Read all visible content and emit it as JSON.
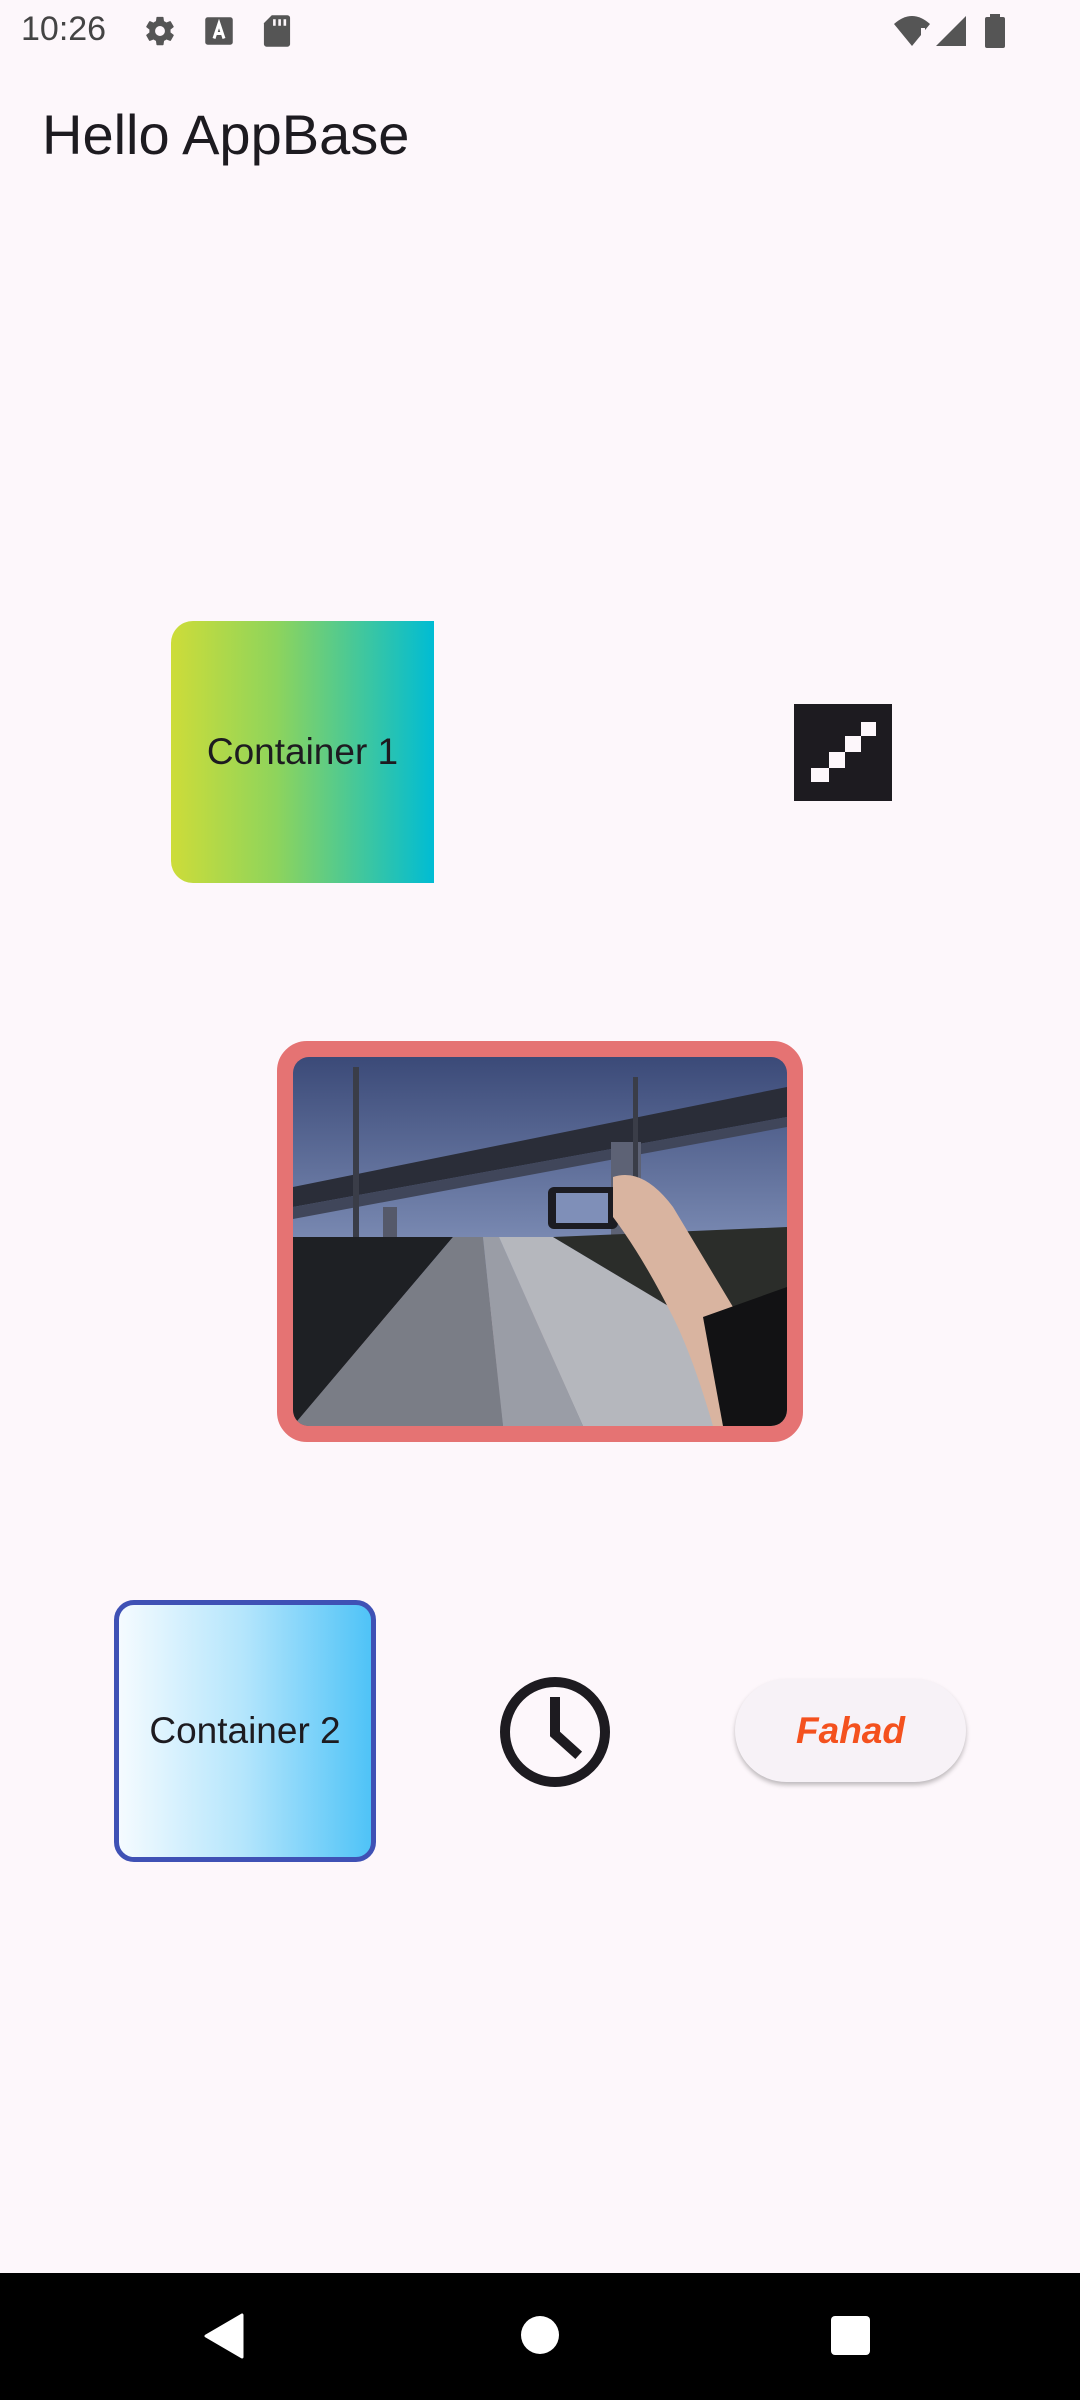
{
  "status_bar": {
    "time": "10:26",
    "left_icons": [
      "settings-icon",
      "text-a-icon",
      "sd-card-icon"
    ],
    "right_icons": [
      "wifi-alert-icon",
      "cell-signal-icon",
      "battery-icon"
    ]
  },
  "app_bar": {
    "title": "Hello AppBase"
  },
  "container1": {
    "label": "Container 1",
    "gradient": [
      "#cddc39",
      "#00bcd4"
    ]
  },
  "stairs": {
    "icon": "stairs-icon"
  },
  "photo": {
    "icon": "photo-image",
    "border_color": "#e57373"
  },
  "container2": {
    "label": "Container 2",
    "gradient": [
      "#f5fbff",
      "#4fc3f7"
    ],
    "border_color": "#3f51b5"
  },
  "clock": {
    "icon": "clock-icon"
  },
  "button": {
    "label": "Fahad",
    "color": "#f4511e"
  },
  "nav_bar": {
    "icons": [
      "back-icon",
      "home-icon",
      "recents-icon"
    ]
  }
}
